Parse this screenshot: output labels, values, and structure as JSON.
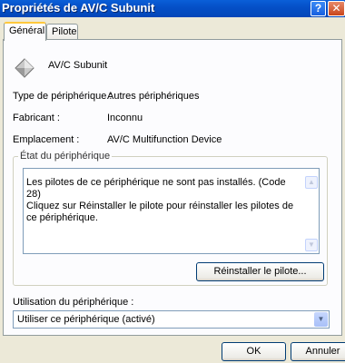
{
  "window": {
    "title": "Propriétés de AV/C Subunit",
    "help_label": "?",
    "close_label": "✕"
  },
  "tabs": [
    {
      "label": "Général",
      "active": true
    },
    {
      "label": "Pilote",
      "active": false
    }
  ],
  "device": {
    "icon": "device-diamond-icon",
    "name": "AV/C Subunit"
  },
  "properties": [
    {
      "label": "Type de périphérique :",
      "value": "Autres périphériques"
    },
    {
      "label": "Fabricant :",
      "value": "Inconnu"
    },
    {
      "label": "Emplacement :",
      "value": "AV/C Multifunction Device"
    }
  ],
  "status": {
    "group_title": "État du périphérique",
    "line1": "Les pilotes de ce périphérique ne sont pas installés. (Code 28)",
    "line2": "Cliquez sur Réinstaller le pilote pour réinstaller les pilotes de ce périphérique.",
    "reinstall_label": "Réinstaller le pilote..."
  },
  "usage": {
    "label": "Utilisation du périphérique :",
    "selected": "Utiliser ce périphérique (activé)"
  },
  "buttons": {
    "ok": "OK",
    "cancel": "Annuler"
  },
  "colors": {
    "titlebar": "#0550c8",
    "tab_highlight": "#ffc83c",
    "panel": "#fcfcfe",
    "dialog": "#ece9d8"
  }
}
